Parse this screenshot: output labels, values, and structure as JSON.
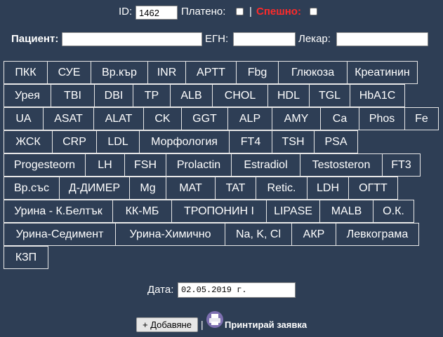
{
  "top": {
    "id_label": "ID:",
    "id_value": "1462",
    "paid_label": "Платено:",
    "separator": "|",
    "urgent_label": "Спешно:",
    "urgent_color": "#ff2a2a"
  },
  "patient_row": {
    "patient_label": "Пациент:",
    "patient_value": "",
    "egn_label": "ЕГН:",
    "egn_value": "",
    "doctor_label": "Лекар:",
    "doctor_value": ""
  },
  "tests": [
    [
      "ПКК",
      "СУЕ",
      "Вр.кър",
      "INR",
      "APTT",
      "Fbg",
      "Глюкоза",
      "Креатинин"
    ],
    [
      "Урея",
      "TBI",
      "DBI",
      "TP",
      "ALB",
      "CHOL",
      "HDL",
      "TGL",
      "HbA1C"
    ],
    [
      "UA",
      "ASAT",
      "ALAT",
      "CK",
      "GGT",
      "ALP",
      "AMY",
      "Ca",
      "Phos",
      "Fe"
    ],
    [
      "ЖСК",
      "CRP",
      "LDL",
      "Морфология",
      "FT4",
      "TSH",
      "PSA"
    ],
    [
      "Progesteorn",
      "LH",
      "FSH",
      "Prolactin",
      "Estradiol",
      "Testosteron",
      "FT3"
    ],
    [
      "Вр.със",
      "Д-ДИМЕР",
      "Mg",
      "MAT",
      "TAT",
      "Retic.",
      "LDH",
      "ОГТТ"
    ],
    [
      "Урина - К.Белтък",
      "КК-МБ",
      "ТРОПОНИН I",
      "LIPASE",
      "MALB",
      "О.К."
    ],
    [
      "Урина-Седимент",
      "Урина-Химично",
      "Na, K, Cl",
      "АКР",
      "Левкограма"
    ],
    [
      "КЗП"
    ]
  ],
  "date": {
    "label": "Дата:",
    "value": "02.05.2019 г."
  },
  "actions": {
    "add_label": "+ Добавяне",
    "separator": "|",
    "print_label": "Принтирай заявка",
    "print_icon": "printer-icon"
  },
  "colors": {
    "background": "#2e3e55",
    "button_border": "#e8e8e8"
  }
}
